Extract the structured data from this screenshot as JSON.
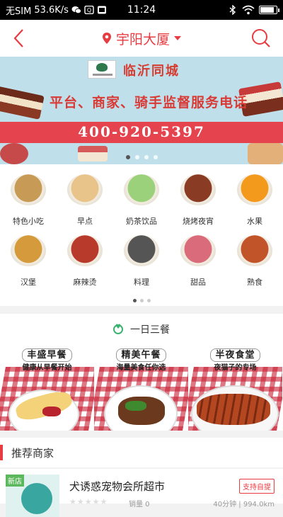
{
  "status_bar": {
    "carrier": "无SIM",
    "speed": "53.6K/s",
    "time": "11:24",
    "battery_level": 0.9
  },
  "nav": {
    "location": "宇阳大厦"
  },
  "banner": {
    "brand": "临沂同城",
    "slogan": "平台、商家、骑手监督服务电话",
    "phone": "400-920-5397",
    "slide_count": 4,
    "active_slide": 1
  },
  "categories": [
    {
      "label": "特色小吃",
      "icon": "snack-icon",
      "color": "#c79a55"
    },
    {
      "label": "早点",
      "icon": "dumpling-icon",
      "color": "#e8c48a"
    },
    {
      "label": "奶茶饮品",
      "icon": "milk-tea-icon",
      "color": "#9bd17a"
    },
    {
      "label": "烧烤夜宵",
      "icon": "bbq-icon",
      "color": "#8a3b24"
    },
    {
      "label": "水果",
      "icon": "orange-icon",
      "color": "#f39a1c"
    },
    {
      "label": "汉堡",
      "icon": "burger-icon",
      "color": "#d49a3c"
    },
    {
      "label": "麻辣烫",
      "icon": "spicy-hotpot-icon",
      "color": "#b83a2a"
    },
    {
      "label": "料理",
      "icon": "sushi-icon",
      "color": "#555555"
    },
    {
      "label": "甜品",
      "icon": "cupcake-icon",
      "color": "#d96b7a"
    },
    {
      "label": "熟食",
      "icon": "cooked-food-icon",
      "color": "#c2542a"
    }
  ],
  "category_pages": 3,
  "category_active_page": 1,
  "meals": {
    "title": "一日三餐",
    "items": [
      {
        "name": "丰盛早餐",
        "sub": "健康从早餐开始"
      },
      {
        "name": "精美午餐",
        "sub": "海量美食任你选"
      },
      {
        "name": "半夜食堂",
        "sub": "夜猫子的专场"
      }
    ]
  },
  "recommend": {
    "title": "推荐商家"
  },
  "merchant": {
    "badge": "新店",
    "name": "犬诱惑宠物会所超市",
    "tag": "支持自提",
    "stars": "★★★★★",
    "sales": "销量 0",
    "distance": "40分钟 | 994.0km"
  }
}
